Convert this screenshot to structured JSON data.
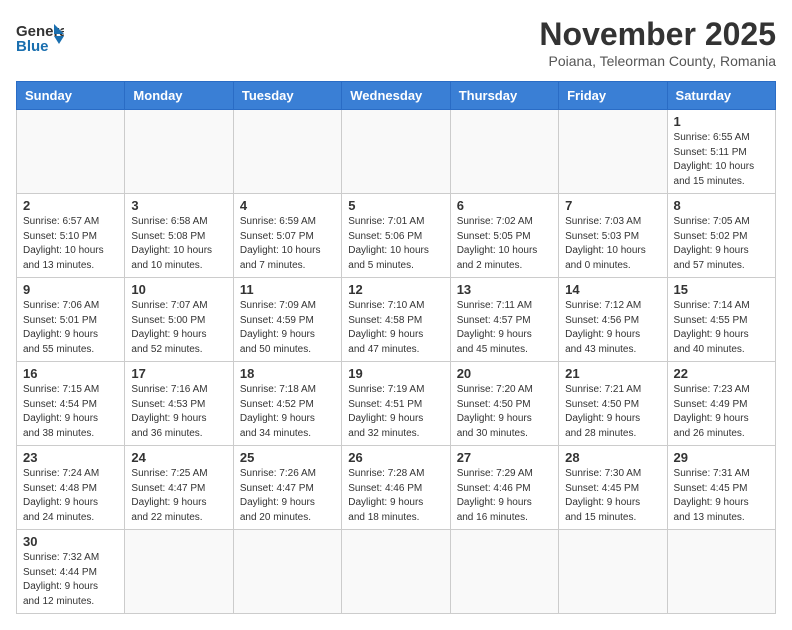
{
  "header": {
    "logo_general": "General",
    "logo_blue": "Blue",
    "month_title": "November 2025",
    "subtitle": "Poiana, Teleorman County, Romania"
  },
  "days_of_week": [
    "Sunday",
    "Monday",
    "Tuesday",
    "Wednesday",
    "Thursday",
    "Friday",
    "Saturday"
  ],
  "weeks": [
    [
      {
        "day": "",
        "info": ""
      },
      {
        "day": "",
        "info": ""
      },
      {
        "day": "",
        "info": ""
      },
      {
        "day": "",
        "info": ""
      },
      {
        "day": "",
        "info": ""
      },
      {
        "day": "",
        "info": ""
      },
      {
        "day": "1",
        "info": "Sunrise: 6:55 AM\nSunset: 5:11 PM\nDaylight: 10 hours\nand 15 minutes."
      }
    ],
    [
      {
        "day": "2",
        "info": "Sunrise: 6:57 AM\nSunset: 5:10 PM\nDaylight: 10 hours\nand 13 minutes."
      },
      {
        "day": "3",
        "info": "Sunrise: 6:58 AM\nSunset: 5:08 PM\nDaylight: 10 hours\nand 10 minutes."
      },
      {
        "day": "4",
        "info": "Sunrise: 6:59 AM\nSunset: 5:07 PM\nDaylight: 10 hours\nand 7 minutes."
      },
      {
        "day": "5",
        "info": "Sunrise: 7:01 AM\nSunset: 5:06 PM\nDaylight: 10 hours\nand 5 minutes."
      },
      {
        "day": "6",
        "info": "Sunrise: 7:02 AM\nSunset: 5:05 PM\nDaylight: 10 hours\nand 2 minutes."
      },
      {
        "day": "7",
        "info": "Sunrise: 7:03 AM\nSunset: 5:03 PM\nDaylight: 10 hours\nand 0 minutes."
      },
      {
        "day": "8",
        "info": "Sunrise: 7:05 AM\nSunset: 5:02 PM\nDaylight: 9 hours\nand 57 minutes."
      }
    ],
    [
      {
        "day": "9",
        "info": "Sunrise: 7:06 AM\nSunset: 5:01 PM\nDaylight: 9 hours\nand 55 minutes."
      },
      {
        "day": "10",
        "info": "Sunrise: 7:07 AM\nSunset: 5:00 PM\nDaylight: 9 hours\nand 52 minutes."
      },
      {
        "day": "11",
        "info": "Sunrise: 7:09 AM\nSunset: 4:59 PM\nDaylight: 9 hours\nand 50 minutes."
      },
      {
        "day": "12",
        "info": "Sunrise: 7:10 AM\nSunset: 4:58 PM\nDaylight: 9 hours\nand 47 minutes."
      },
      {
        "day": "13",
        "info": "Sunrise: 7:11 AM\nSunset: 4:57 PM\nDaylight: 9 hours\nand 45 minutes."
      },
      {
        "day": "14",
        "info": "Sunrise: 7:12 AM\nSunset: 4:56 PM\nDaylight: 9 hours\nand 43 minutes."
      },
      {
        "day": "15",
        "info": "Sunrise: 7:14 AM\nSunset: 4:55 PM\nDaylight: 9 hours\nand 40 minutes."
      }
    ],
    [
      {
        "day": "16",
        "info": "Sunrise: 7:15 AM\nSunset: 4:54 PM\nDaylight: 9 hours\nand 38 minutes."
      },
      {
        "day": "17",
        "info": "Sunrise: 7:16 AM\nSunset: 4:53 PM\nDaylight: 9 hours\nand 36 minutes."
      },
      {
        "day": "18",
        "info": "Sunrise: 7:18 AM\nSunset: 4:52 PM\nDaylight: 9 hours\nand 34 minutes."
      },
      {
        "day": "19",
        "info": "Sunrise: 7:19 AM\nSunset: 4:51 PM\nDaylight: 9 hours\nand 32 minutes."
      },
      {
        "day": "20",
        "info": "Sunrise: 7:20 AM\nSunset: 4:50 PM\nDaylight: 9 hours\nand 30 minutes."
      },
      {
        "day": "21",
        "info": "Sunrise: 7:21 AM\nSunset: 4:50 PM\nDaylight: 9 hours\nand 28 minutes."
      },
      {
        "day": "22",
        "info": "Sunrise: 7:23 AM\nSunset: 4:49 PM\nDaylight: 9 hours\nand 26 minutes."
      }
    ],
    [
      {
        "day": "23",
        "info": "Sunrise: 7:24 AM\nSunset: 4:48 PM\nDaylight: 9 hours\nand 24 minutes."
      },
      {
        "day": "24",
        "info": "Sunrise: 7:25 AM\nSunset: 4:47 PM\nDaylight: 9 hours\nand 22 minutes."
      },
      {
        "day": "25",
        "info": "Sunrise: 7:26 AM\nSunset: 4:47 PM\nDaylight: 9 hours\nand 20 minutes."
      },
      {
        "day": "26",
        "info": "Sunrise: 7:28 AM\nSunset: 4:46 PM\nDaylight: 9 hours\nand 18 minutes."
      },
      {
        "day": "27",
        "info": "Sunrise: 7:29 AM\nSunset: 4:46 PM\nDaylight: 9 hours\nand 16 minutes."
      },
      {
        "day": "28",
        "info": "Sunrise: 7:30 AM\nSunset: 4:45 PM\nDaylight: 9 hours\nand 15 minutes."
      },
      {
        "day": "29",
        "info": "Sunrise: 7:31 AM\nSunset: 4:45 PM\nDaylight: 9 hours\nand 13 minutes."
      }
    ],
    [
      {
        "day": "30",
        "info": "Sunrise: 7:32 AM\nSunset: 4:44 PM\nDaylight: 9 hours\nand 12 minutes."
      },
      {
        "day": "",
        "info": ""
      },
      {
        "day": "",
        "info": ""
      },
      {
        "day": "",
        "info": ""
      },
      {
        "day": "",
        "info": ""
      },
      {
        "day": "",
        "info": ""
      },
      {
        "day": "",
        "info": ""
      }
    ]
  ]
}
